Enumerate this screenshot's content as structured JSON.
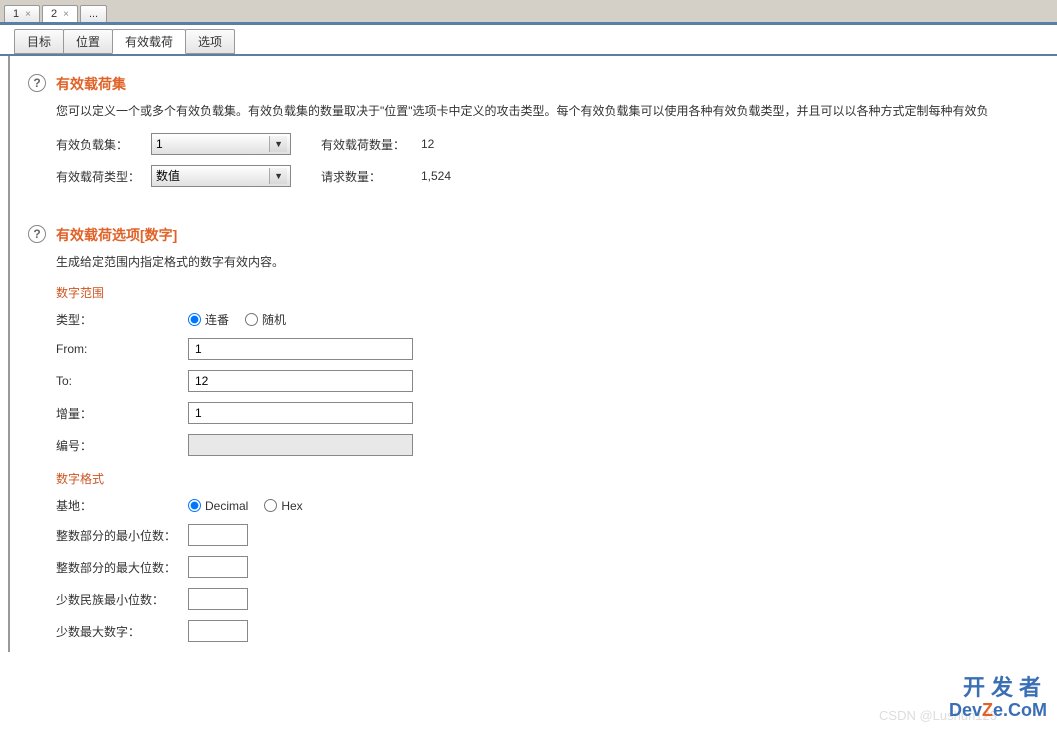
{
  "topTabs": [
    {
      "label": "1"
    },
    {
      "label": "2"
    },
    {
      "label": "..."
    }
  ],
  "subTabs": [
    {
      "label": "目标"
    },
    {
      "label": "位置"
    },
    {
      "label": "有效载荷"
    },
    {
      "label": "选项"
    }
  ],
  "section1": {
    "title": "有效载荷集",
    "desc": "您可以定义一个或多个有效负载集。有效负载集的数量取决于\"位置\"选项卡中定义的攻击类型。每个有效负载集可以使用各种有效负载类型，并且可以以各种方式定制每种有效负",
    "payloadSetLabel": "有效负载集：",
    "payloadSetValue": "1",
    "payloadTypeLabel": "有效载荷类型：",
    "payloadTypeValue": "数值",
    "payloadCountLabel": "有效载荷数量：",
    "payloadCountValue": "12",
    "requestCountLabel": "请求数量：",
    "requestCountValue": "1,524"
  },
  "section2": {
    "title": "有效载荷选项[数字]",
    "desc": "生成给定范围内指定格式的数字有效内容。",
    "numberRange": {
      "heading": "数字范围",
      "typeLabel": "类型：",
      "sequentialLabel": "连番",
      "randomLabel": "随机",
      "fromLabel": "From:",
      "fromValue": "1",
      "toLabel": "To:",
      "toValue": "12",
      "stepLabel": "增量：",
      "stepValue": "1",
      "howManyLabel": "编号：",
      "howManyValue": ""
    },
    "numberFormat": {
      "heading": "数字格式",
      "baseLabel": "基地：",
      "decimalLabel": "Decimal",
      "hexLabel": "Hex",
      "minIntLabel": "整数部分的最小位数：",
      "minIntValue": "",
      "maxIntLabel": "整数部分的最大位数：",
      "maxIntValue": "",
      "minFracLabel": "少数民族最小位数：",
      "minFracValue": "",
      "maxFracLabel": "少数最大数字：",
      "maxFracValue": ""
    }
  },
  "watermark": {
    "ch": "开发者",
    "en1": "Dev",
    "en2": "Z",
    "en3": "e.CoM"
  },
  "csdn": "CSDN @Lushun123"
}
